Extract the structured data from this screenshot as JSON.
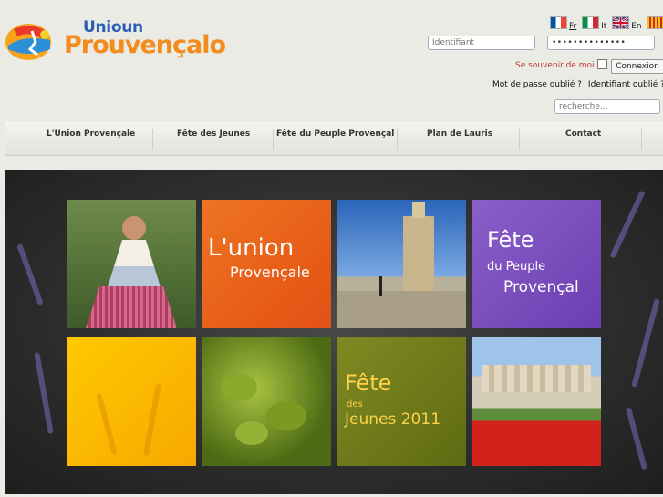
{
  "logo": {
    "line1": "Unioun",
    "line2": "Prouvençalo"
  },
  "languages": [
    {
      "code": "Fr",
      "active": true
    },
    {
      "code": "It",
      "active": false
    },
    {
      "code": "En",
      "active": false
    },
    {
      "code": "Pr",
      "active": false
    }
  ],
  "login": {
    "username_placeholder": "Identifiant",
    "password_value": "••••••••••••••",
    "remember_label": "Se souvenir de moi",
    "submit_label": "Connexion",
    "forgot_password": "Mot de passe oublié ?",
    "separator": "|",
    "forgot_username": "Identifiant oublié ?"
  },
  "search": {
    "placeholder": "recherche..."
  },
  "nav": {
    "items": [
      "L'Union Provençale",
      "Fête des Jeunes",
      "Fête du Peuple Provençal",
      "Plan de Lauris",
      "Contact"
    ]
  },
  "banner": {
    "tiles": [
      {
        "kind": "photo-woman"
      },
      {
        "kind": "text",
        "line1": "L'union",
        "line2": "Provençale"
      },
      {
        "kind": "photo-church"
      },
      {
        "kind": "text",
        "line1": "Fête",
        "line2": "du Peuple",
        "line3": "Provençal"
      },
      {
        "kind": "color-yellow"
      },
      {
        "kind": "photo-olives"
      },
      {
        "kind": "text",
        "line1": "Fête",
        "line2": "des",
        "line3": "Jeunes 2011"
      },
      {
        "kind": "photo-village"
      }
    ]
  },
  "colors": {
    "accent_orange": "#f28c1c",
    "logo_blue": "#2a5db4",
    "remember_red": "#c0392b"
  }
}
